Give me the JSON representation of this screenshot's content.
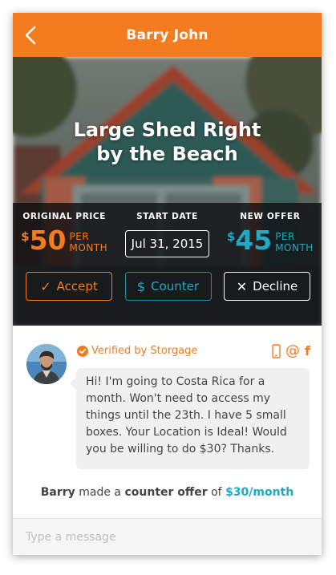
{
  "header": {
    "title": "Barry John",
    "back_icon": "chevron-left-icon"
  },
  "listing": {
    "title_line1": "Large Shed Right",
    "title_line2": "by the Beach"
  },
  "offer": {
    "original_label": "ORIGINAL PRICE",
    "original_symbol": "$",
    "original_amount": "50",
    "original_unit_line1": "PER",
    "original_unit_line2": "MONTH",
    "start_label": "START DATE",
    "start_date": "Jul 31, 2015",
    "new_label": "NEW OFFER",
    "new_symbol": "$",
    "new_amount": "45",
    "new_unit_line1": "PER",
    "new_unit_line2": "MONTH"
  },
  "actions": {
    "accept_glyph": "✓",
    "accept_label": "Accept",
    "counter_glyph": "$",
    "counter_label": "Counter",
    "decline_glyph": "✕",
    "decline_label": "Decline"
  },
  "message": {
    "verified_text": "Verified by Storgage",
    "social_icons": [
      "phone-icon",
      "at-icon",
      "facebook-icon"
    ],
    "body": "Hi! I'm going to Costa Rica for a month. Won't need to access my things until the 23th. I have 5 small boxes. Your Location is Ideal! Would you be willing to do $30? Thanks."
  },
  "counter_note": {
    "name": "Barry",
    "text1": " made a ",
    "bold": "counter offer",
    "text2": " of ",
    "amount": "$30/month"
  },
  "composer": {
    "placeholder": "Type a message"
  },
  "colors": {
    "accent": "#f47b1e",
    "teal": "#1fa9c4",
    "bubble": "#f0f0f0"
  }
}
